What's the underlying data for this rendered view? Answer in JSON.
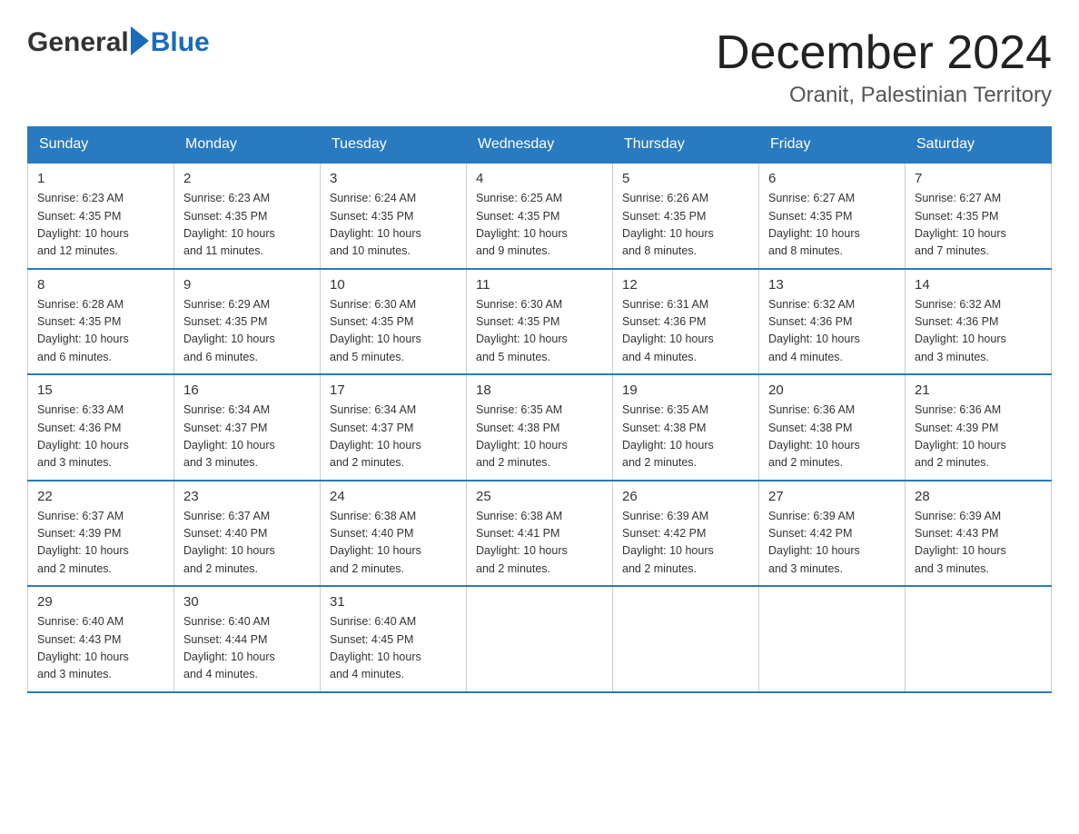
{
  "header": {
    "logo": {
      "general": "General",
      "blue": "Blue"
    },
    "month": "December 2024",
    "location": "Oranit, Palestinian Territory"
  },
  "weekdays": [
    "Sunday",
    "Monday",
    "Tuesday",
    "Wednesday",
    "Thursday",
    "Friday",
    "Saturday"
  ],
  "weeks": [
    [
      {
        "day": "1",
        "sunrise": "6:23 AM",
        "sunset": "4:35 PM",
        "daylight": "10 hours and 12 minutes."
      },
      {
        "day": "2",
        "sunrise": "6:23 AM",
        "sunset": "4:35 PM",
        "daylight": "10 hours and 11 minutes."
      },
      {
        "day": "3",
        "sunrise": "6:24 AM",
        "sunset": "4:35 PM",
        "daylight": "10 hours and 10 minutes."
      },
      {
        "day": "4",
        "sunrise": "6:25 AM",
        "sunset": "4:35 PM",
        "daylight": "10 hours and 9 minutes."
      },
      {
        "day": "5",
        "sunrise": "6:26 AM",
        "sunset": "4:35 PM",
        "daylight": "10 hours and 8 minutes."
      },
      {
        "day": "6",
        "sunrise": "6:27 AM",
        "sunset": "4:35 PM",
        "daylight": "10 hours and 8 minutes."
      },
      {
        "day": "7",
        "sunrise": "6:27 AM",
        "sunset": "4:35 PM",
        "daylight": "10 hours and 7 minutes."
      }
    ],
    [
      {
        "day": "8",
        "sunrise": "6:28 AM",
        "sunset": "4:35 PM",
        "daylight": "10 hours and 6 minutes."
      },
      {
        "day": "9",
        "sunrise": "6:29 AM",
        "sunset": "4:35 PM",
        "daylight": "10 hours and 6 minutes."
      },
      {
        "day": "10",
        "sunrise": "6:30 AM",
        "sunset": "4:35 PM",
        "daylight": "10 hours and 5 minutes."
      },
      {
        "day": "11",
        "sunrise": "6:30 AM",
        "sunset": "4:35 PM",
        "daylight": "10 hours and 5 minutes."
      },
      {
        "day": "12",
        "sunrise": "6:31 AM",
        "sunset": "4:36 PM",
        "daylight": "10 hours and 4 minutes."
      },
      {
        "day": "13",
        "sunrise": "6:32 AM",
        "sunset": "4:36 PM",
        "daylight": "10 hours and 4 minutes."
      },
      {
        "day": "14",
        "sunrise": "6:32 AM",
        "sunset": "4:36 PM",
        "daylight": "10 hours and 3 minutes."
      }
    ],
    [
      {
        "day": "15",
        "sunrise": "6:33 AM",
        "sunset": "4:36 PM",
        "daylight": "10 hours and 3 minutes."
      },
      {
        "day": "16",
        "sunrise": "6:34 AM",
        "sunset": "4:37 PM",
        "daylight": "10 hours and 3 minutes."
      },
      {
        "day": "17",
        "sunrise": "6:34 AM",
        "sunset": "4:37 PM",
        "daylight": "10 hours and 2 minutes."
      },
      {
        "day": "18",
        "sunrise": "6:35 AM",
        "sunset": "4:38 PM",
        "daylight": "10 hours and 2 minutes."
      },
      {
        "day": "19",
        "sunrise": "6:35 AM",
        "sunset": "4:38 PM",
        "daylight": "10 hours and 2 minutes."
      },
      {
        "day": "20",
        "sunrise": "6:36 AM",
        "sunset": "4:38 PM",
        "daylight": "10 hours and 2 minutes."
      },
      {
        "day": "21",
        "sunrise": "6:36 AM",
        "sunset": "4:39 PM",
        "daylight": "10 hours and 2 minutes."
      }
    ],
    [
      {
        "day": "22",
        "sunrise": "6:37 AM",
        "sunset": "4:39 PM",
        "daylight": "10 hours and 2 minutes."
      },
      {
        "day": "23",
        "sunrise": "6:37 AM",
        "sunset": "4:40 PM",
        "daylight": "10 hours and 2 minutes."
      },
      {
        "day": "24",
        "sunrise": "6:38 AM",
        "sunset": "4:40 PM",
        "daylight": "10 hours and 2 minutes."
      },
      {
        "day": "25",
        "sunrise": "6:38 AM",
        "sunset": "4:41 PM",
        "daylight": "10 hours and 2 minutes."
      },
      {
        "day": "26",
        "sunrise": "6:39 AM",
        "sunset": "4:42 PM",
        "daylight": "10 hours and 2 minutes."
      },
      {
        "day": "27",
        "sunrise": "6:39 AM",
        "sunset": "4:42 PM",
        "daylight": "10 hours and 3 minutes."
      },
      {
        "day": "28",
        "sunrise": "6:39 AM",
        "sunset": "4:43 PM",
        "daylight": "10 hours and 3 minutes."
      }
    ],
    [
      {
        "day": "29",
        "sunrise": "6:40 AM",
        "sunset": "4:43 PM",
        "daylight": "10 hours and 3 minutes."
      },
      {
        "day": "30",
        "sunrise": "6:40 AM",
        "sunset": "4:44 PM",
        "daylight": "10 hours and 4 minutes."
      },
      {
        "day": "31",
        "sunrise": "6:40 AM",
        "sunset": "4:45 PM",
        "daylight": "10 hours and 4 minutes."
      },
      null,
      null,
      null,
      null
    ]
  ],
  "labels": {
    "sunrise": "Sunrise:",
    "sunset": "Sunset:",
    "daylight": "Daylight:"
  }
}
